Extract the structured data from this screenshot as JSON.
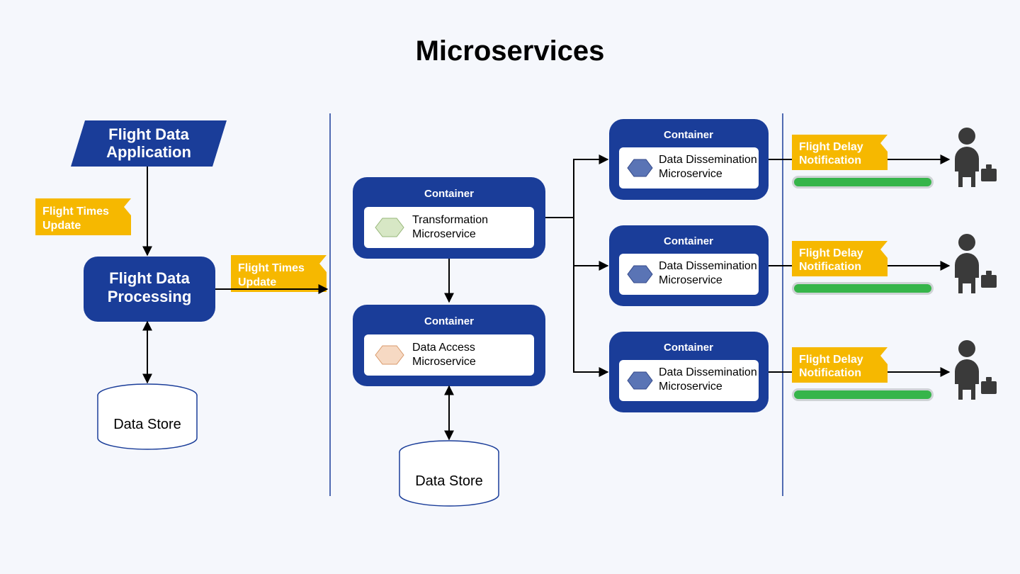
{
  "title": "Microservices",
  "app": {
    "line1": "Flight Data",
    "line2": "Application"
  },
  "flightTimesUpdate": {
    "line1": "Flight Times",
    "line2": "Update"
  },
  "flightDataProcessing": {
    "line1": "Flight Data",
    "line2": "Processing"
  },
  "dataStore": "Data Store",
  "containerLabel": "Container",
  "micro": {
    "transformation": {
      "line1": "Transformation",
      "line2": "Microservice"
    },
    "dataAccess": {
      "line1": "Data Access",
      "line2": "Microservice"
    },
    "dissemination": {
      "line1": "Data Dissemination",
      "line2": "Microservice"
    }
  },
  "notification": {
    "line1": "Flight Delay",
    "line2": "Notification"
  },
  "colors": {
    "blue": "#1a3d99",
    "yellow": "#f6b800",
    "green": "#36b54a",
    "hexGreen": "#d7e7c5",
    "hexOrange": "#f6d9c3",
    "hexBlue": "#5a74b5",
    "person": "#3a3a3a"
  }
}
